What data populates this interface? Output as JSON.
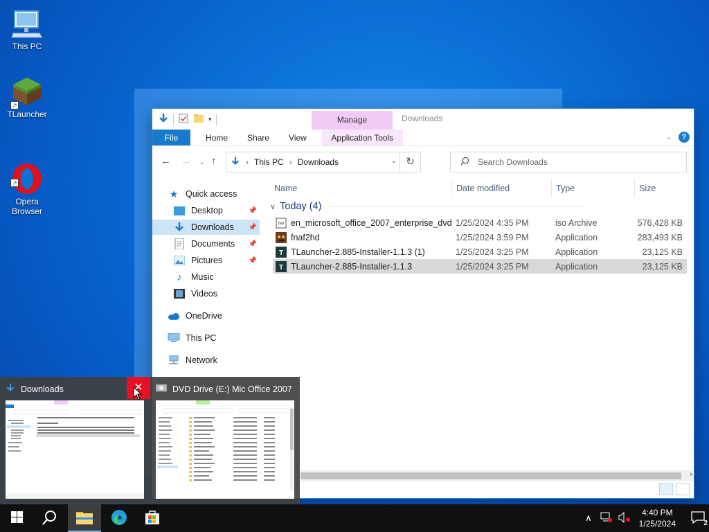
{
  "desktop": {
    "icons": [
      {
        "label": "This PC"
      },
      {
        "label": "TLauncher"
      },
      {
        "label": "Opera\nBrowser"
      }
    ]
  },
  "explorer": {
    "title": "Downloads",
    "context_tab": "Manage",
    "ribbon_tabs": {
      "file": "File",
      "home": "Home",
      "share": "Share",
      "view": "View",
      "app_tools": "Application Tools"
    },
    "address": {
      "crumbs": [
        "This PC",
        "Downloads"
      ]
    },
    "search": {
      "placeholder": "Search Downloads"
    },
    "nav": {
      "quick_access": "Quick access",
      "items": [
        {
          "label": "Desktop",
          "pinned": true
        },
        {
          "label": "Downloads",
          "pinned": true,
          "selected": true
        },
        {
          "label": "Documents",
          "pinned": true
        },
        {
          "label": "Pictures",
          "pinned": true
        },
        {
          "label": "Music",
          "pinned": false
        },
        {
          "label": "Videos",
          "pinned": false
        }
      ],
      "onedrive": "OneDrive",
      "this_pc": "This PC",
      "network": "Network"
    },
    "columns": {
      "name": "Name",
      "date": "Date modified",
      "type": "Type",
      "size": "Size"
    },
    "group": "Today (4)",
    "files": [
      {
        "name": "en_microsoft_office_2007_enterprise_dvd",
        "date": "1/25/2024 4:35 PM",
        "type": "iso Archive",
        "size": "576,428 KB",
        "icon": "iso-icon"
      },
      {
        "name": "fnaf2hd",
        "date": "1/25/2024 3:59 PM",
        "type": "Application",
        "size": "283,493 KB",
        "icon": "fnaf-icon"
      },
      {
        "name": "TLauncher-2.885-Installer-1.1.3 (1)",
        "date": "1/25/2024 3:25 PM",
        "type": "Application",
        "size": "23,125 KB",
        "icon": "tlauncher-icon"
      },
      {
        "name": "TLauncher-2.885-Installer-1.1.3",
        "date": "1/25/2024 3:25 PM",
        "type": "Application",
        "size": "23,125 KB",
        "icon": "tlauncher-icon",
        "selected": true
      }
    ]
  },
  "thumbnails": [
    {
      "title": "Downloads"
    },
    {
      "title": "DVD Drive (E:) Mic  Office 2007"
    }
  ],
  "taskbar": {
    "time": "4:40 PM",
    "date": "1/25/2024",
    "notifications": "2"
  },
  "colors": {
    "accent": "#1979ca",
    "manage": "#f0ccf5",
    "close": "#e81123"
  }
}
